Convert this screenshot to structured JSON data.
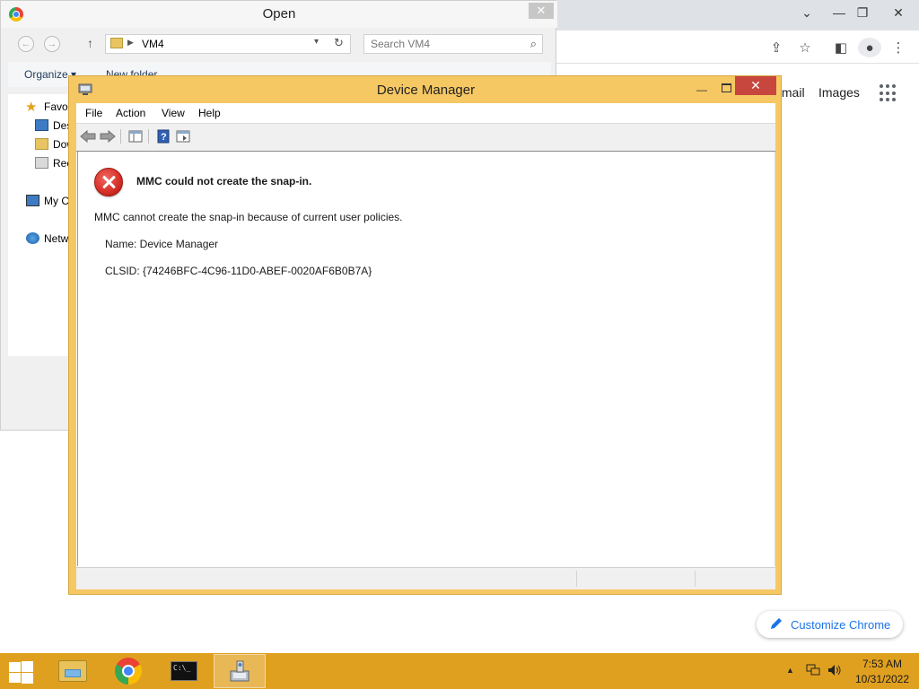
{
  "chrome": {
    "links": [
      "Gmail",
      "Images"
    ],
    "customize_label": "Customize Chrome"
  },
  "open_dialog": {
    "title": "Open",
    "close_glyph": "✕",
    "address": "VM4",
    "search_placeholder": "Search VM4",
    "organize_label": "Organize ▾",
    "new_folder_label": "New folder",
    "nav_items": [
      "Favorites",
      "Desktop",
      "Downloads",
      "Recent places",
      "My Computer",
      "Network"
    ]
  },
  "device_manager": {
    "title": "Device Manager",
    "close_glyph": "✕",
    "minimize_glyph": "—",
    "menu": [
      "File",
      "Action",
      "View",
      "Help"
    ],
    "error_heading": "MMC could not create the snap-in.",
    "error_message": "MMC cannot create the snap-in because of current user policies.",
    "name_line": "Name: Device Manager",
    "clsid_line": "CLSID: {74246BFC-4C96-11D0-ABEF-0020AF6B0B7A}"
  },
  "taskbar": {
    "apps": [
      "File Explorer",
      "Google Chrome",
      "Command Prompt",
      "Device Manager"
    ],
    "active_app": "Device Manager",
    "clock_time": "7:53 AM",
    "clock_date": "10/31/2022"
  },
  "colors": {
    "taskbar": "#e0a01f",
    "dm_frame": "#f6c864",
    "close_red": "#c7463d",
    "chrome_link_blue": "#1a73e8"
  }
}
